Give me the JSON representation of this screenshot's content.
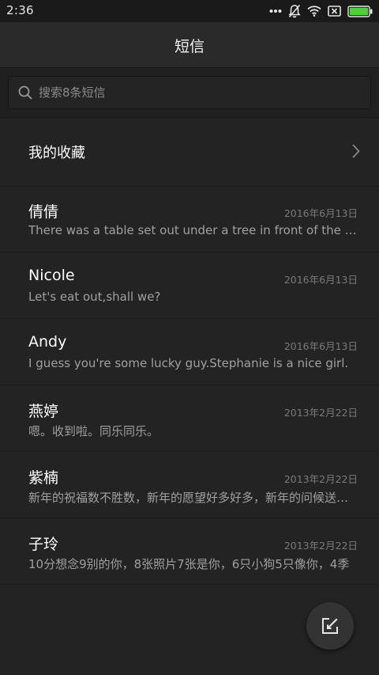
{
  "status_bar": {
    "time": "2:36",
    "icons": [
      "more-dots-icon",
      "bell-muted-icon",
      "wifi-icon",
      "sim-no-signal-icon",
      "battery-icon"
    ],
    "battery_color": "#4cd137"
  },
  "header": {
    "title": "短信"
  },
  "search": {
    "placeholder": "搜索8条短信"
  },
  "favorites": {
    "label": "我的收藏"
  },
  "threads": [
    {
      "name": "倩倩",
      "date": "2016年6月13日",
      "snippet": "There was a table set out under a tree in front of the house"
    },
    {
      "name": "Nicole",
      "date": "2016年6月13日",
      "snippet": "Let's eat out,shall we?"
    },
    {
      "name": "Andy",
      "date": "2016年6月13日",
      "snippet": "I guess you're some lucky guy.Stephanie is a nice girl."
    },
    {
      "name": "燕婷",
      "date": "2013年2月22日",
      "snippet": "嗯。收到啦。同乐同乐。"
    },
    {
      "name": "紫楠",
      "date": "2013年2月22日",
      "snippet": "新年的祝福数不胜数，新年的愿望好多好多，新年的问候送给你"
    },
    {
      "name": "子玲",
      "date": "2013年2月22日",
      "snippet": "10分想念9别的你，8张照片7张是你，6只小狗5只像你，4季"
    }
  ],
  "colors": {
    "background": "#232323",
    "header": "#2a2a2a",
    "primary_text": "#ffffff",
    "secondary_text": "#a0a0a0",
    "date_text": "#7a7a7a"
  }
}
